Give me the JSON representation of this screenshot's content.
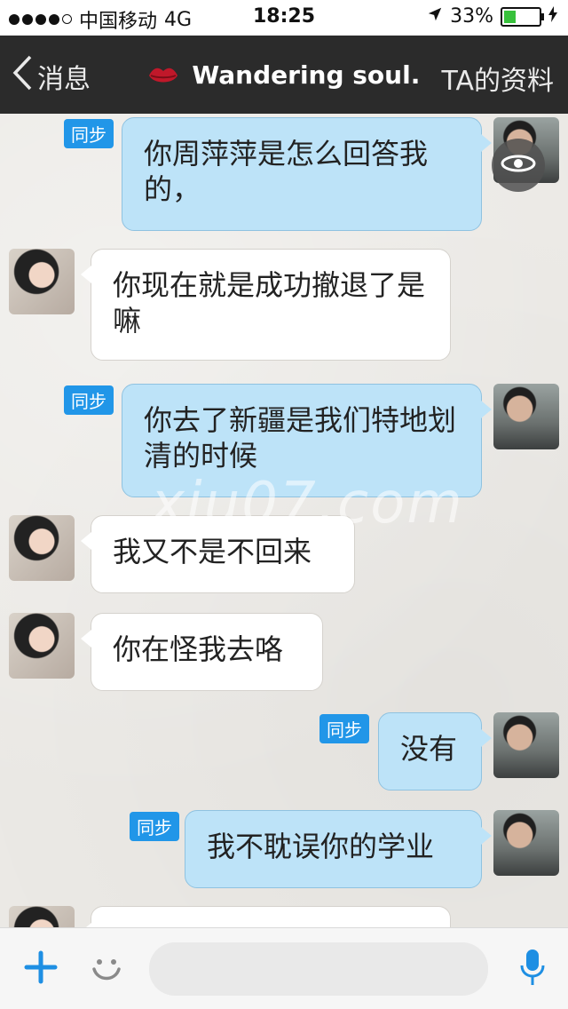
{
  "status_bar": {
    "carrier": "中国移动",
    "network": "4G",
    "time": "18:25",
    "battery": "33%",
    "battery_level": 0.33
  },
  "nav": {
    "back_label": "消息",
    "title": "Wandering soul.",
    "profile_label": "TA的资料"
  },
  "messages": [
    {
      "sender": "me",
      "text": "你周萍萍是怎么回答我的，",
      "badge": "同步"
    },
    {
      "sender": "other",
      "text": "你现在就是成功撤退了是嘛"
    },
    {
      "sender": "me",
      "text": "你去了新疆是我们特地划清的时候",
      "badge": "同步"
    },
    {
      "sender": "other",
      "text": "我又不是不回来"
    },
    {
      "sender": "other",
      "text": "你在怪我去咯"
    },
    {
      "sender": "me",
      "text": "没有",
      "badge": "同步"
    },
    {
      "sender": "me",
      "text": "我不耽误你的学业",
      "badge": "同步"
    }
  ],
  "watermark": "xiu07.com",
  "colors": {
    "accent": "#2196e8",
    "my_bubble": "#bde3f8",
    "nav_bg": "#2b2b2b"
  }
}
